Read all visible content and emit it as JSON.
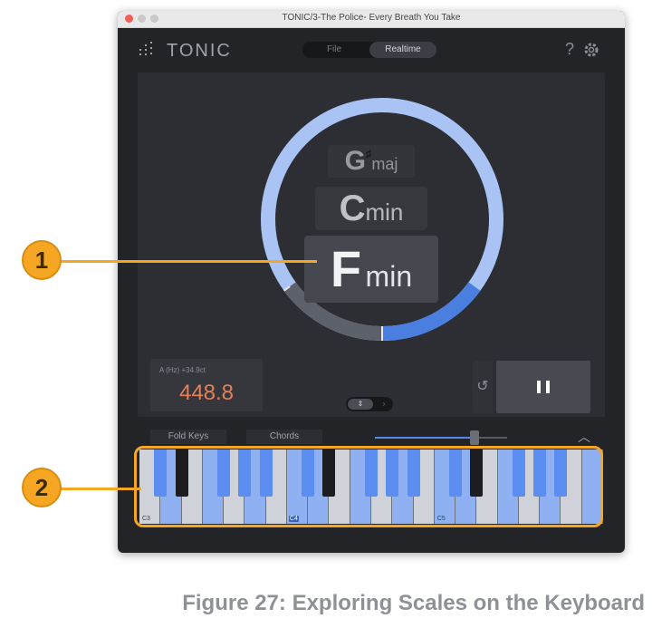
{
  "window": {
    "title": "TONIC/3-The Police- Every Breath You Take"
  },
  "header": {
    "brand": "TONIC",
    "modes": [
      {
        "label": "File",
        "active": false
      },
      {
        "label": "Realtime",
        "active": true
      }
    ],
    "help_label": "?",
    "icons": {
      "logo": "bars-logo-icon",
      "settings": "gear-icon"
    }
  },
  "chords": [
    {
      "root": "G",
      "accidental": "♯",
      "quality": "maj"
    },
    {
      "root": "C",
      "accidental": "",
      "quality": "min"
    },
    {
      "root": "F",
      "accidental": "",
      "quality": "min"
    }
  ],
  "tuner": {
    "label": "A (Hz)  +34.9ct",
    "value": "448.8"
  },
  "toggle": {
    "left": "⇕",
    "right": "›"
  },
  "transport": {
    "undo_icon": "undo-icon",
    "pause_icon": "pause-icon"
  },
  "keyboard_bar": {
    "fold_keys": "Fold Keys",
    "chords": "Chords",
    "zoom_level": 0.75,
    "collapse_icon": "chevron-up-icon"
  },
  "keyboard": {
    "octave_labels": [
      "C3",
      "C4",
      "C5"
    ],
    "active_label": "C4",
    "white_active": [
      false,
      true,
      false,
      true,
      false,
      true,
      false,
      true,
      true,
      false,
      true,
      false,
      true,
      false,
      true,
      true,
      false,
      true,
      false,
      true,
      false,
      true
    ],
    "black_active": [
      true,
      false,
      true,
      true,
      true,
      true,
      false,
      true,
      true,
      true,
      true,
      false,
      true,
      true,
      true
    ]
  },
  "annotations": [
    "1",
    "2"
  ],
  "caption": "Figure 27: Exploring Scales on the Keyboard",
  "colors": {
    "ring_blue": "#a9c3f4",
    "ring_active": "#4a7fe0",
    "key_active": "#8fb1f2",
    "black_key_active": "#5b8ef0",
    "tuner_value": "#e57f58",
    "annotation": "#f5a623"
  }
}
